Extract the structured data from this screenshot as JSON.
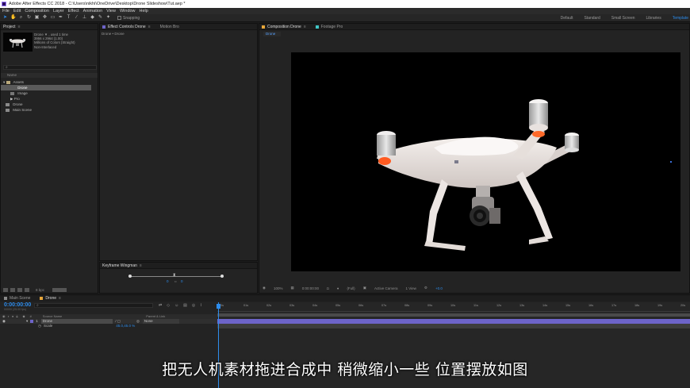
{
  "window": {
    "title": "Adobe After Effects CC 2018 - C:\\Users\\nikhi\\OneDrive\\Desktop\\Drone Slideshow\\Tut.aep *"
  },
  "menu": [
    "File",
    "Edit",
    "Composition",
    "Layer",
    "Effect",
    "Animation",
    "View",
    "Window",
    "Help"
  ],
  "toolbar": {
    "tools": [
      "selection-tool",
      "hand-tool",
      "zoom-tool",
      "rotate-tool",
      "camera-tool",
      "pan-behind-tool",
      "rectangle-tool",
      "pen-tool",
      "text-tool",
      "brush-tool",
      "clone-stamp-tool",
      "eraser-tool",
      "roto-brush-tool",
      "puppet-tool"
    ],
    "snapping_label": "Snapping"
  },
  "workspaces": {
    "items": [
      "Default",
      "Standard",
      "Small Screen",
      "Libraries",
      "Template"
    ],
    "active": "Template"
  },
  "project": {
    "tab": "Project",
    "meta": {
      "name": "Drone ▼ , used 1 time",
      "size": "3956 x 2964 (1.00)",
      "colors": "Millions of Colors (Straight)",
      "interlace": "Non-Interlaced"
    },
    "search_icon": "magnifier",
    "column_header": "Name",
    "items": [
      {
        "label": "Assets",
        "type": "folder"
      },
      {
        "label": "Drone",
        "type": "image",
        "selected": true
      },
      {
        "label": "Image",
        "type": "image"
      },
      {
        "label": "Pro",
        "type": "footage"
      },
      {
        "label": "Drone",
        "type": "composition"
      },
      {
        "label": "Main Scene",
        "type": "composition"
      }
    ],
    "footer_bpc": "8 bpc"
  },
  "effects": {
    "tab": "Effect Controls Drone",
    "tab2": "Motion Bro",
    "subtitle": "Drone • Drone"
  },
  "keyframe": {
    "tab": "Keyframe Wingman",
    "value_a": "0",
    "value_b": "0"
  },
  "composition": {
    "tab": "Composition Drone",
    "tab2": "Footage Pro",
    "subtab": "Drone",
    "controls": {
      "zoom": "100%",
      "timecode": "0:00:00:00",
      "resolution": "(Full)",
      "camera": "Active Camera",
      "views": "1 View",
      "exposure": "+0.0"
    }
  },
  "timeline": {
    "tabs": [
      "Main Scene",
      "Drone"
    ],
    "active_tab": "Drone",
    "timecode": "0:00:00:00",
    "fps": "00000 (25.00 fps)",
    "header": {
      "num": "#",
      "source": "Source Name",
      "parent": "Parent & Link"
    },
    "layer": {
      "num": "1",
      "name": "Drone",
      "parent": "None"
    },
    "scale": {
      "label": "Scale",
      "value": "45.0,45.0 %"
    },
    "ruler": [
      "0s",
      "01s",
      "02s",
      "03s",
      "04s",
      "05s",
      "06s",
      "07s",
      "08s",
      "09s",
      "10s",
      "11s",
      "12s",
      "13s",
      "14s",
      "15s",
      "16s",
      "17s",
      "18s",
      "19s",
      "20s"
    ]
  },
  "subtitle": "把无人机素材拖进合成中 稍微缩小一些 位置摆放如图",
  "colors": {
    "accent": "#2d8ceb",
    "layer_bar": "#6d64c9",
    "label_orange": "#e8a73a"
  }
}
